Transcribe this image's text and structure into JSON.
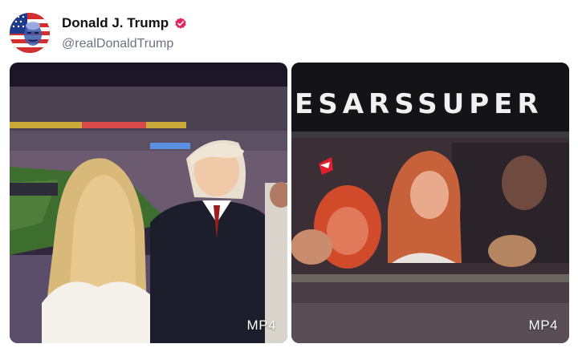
{
  "author": {
    "display_name": "Donald J. Trump",
    "handle": "@realDonaldTrump",
    "verified": true,
    "badge_color": "#e0245e",
    "avatar_icon": "flag-portrait-avatar"
  },
  "media": [
    {
      "type_label": "MP4",
      "description_icon": "stadium-video-thumbnail"
    },
    {
      "type_label": "MP4",
      "scoreboard_text": "ESARSSUPER",
      "description_icon": "jumbotron-video-thumbnail"
    }
  ],
  "colors": {
    "background": "#ffffff",
    "name_text": "#111111",
    "handle_text": "#6b7280"
  }
}
